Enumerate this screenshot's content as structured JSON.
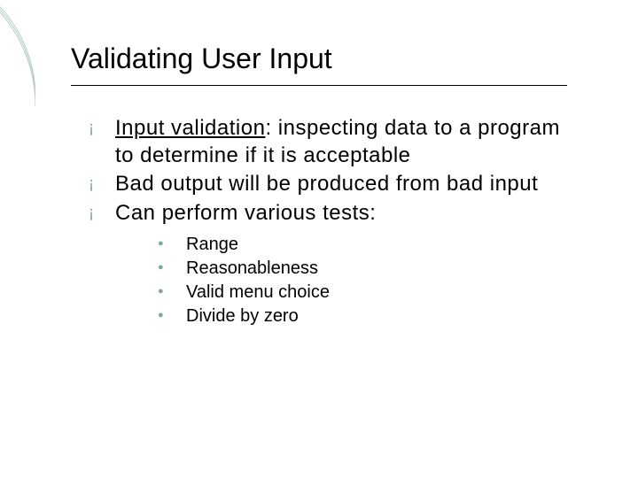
{
  "title": "Validating User Input",
  "bullets": [
    {
      "term": "Input validation",
      "rest": ": inspecting data to a program to determine if it is acceptable"
    },
    {
      "text": "Bad output will be produced from bad input"
    },
    {
      "text": "Can perform various tests:"
    }
  ],
  "subbullets": [
    "Range",
    "Reasonableness",
    "Valid menu choice",
    "Divide by zero"
  ],
  "glyphs": {
    "lvl1": "¡",
    "lvl2": "●"
  },
  "colors": {
    "accent": "#7aa79a"
  }
}
